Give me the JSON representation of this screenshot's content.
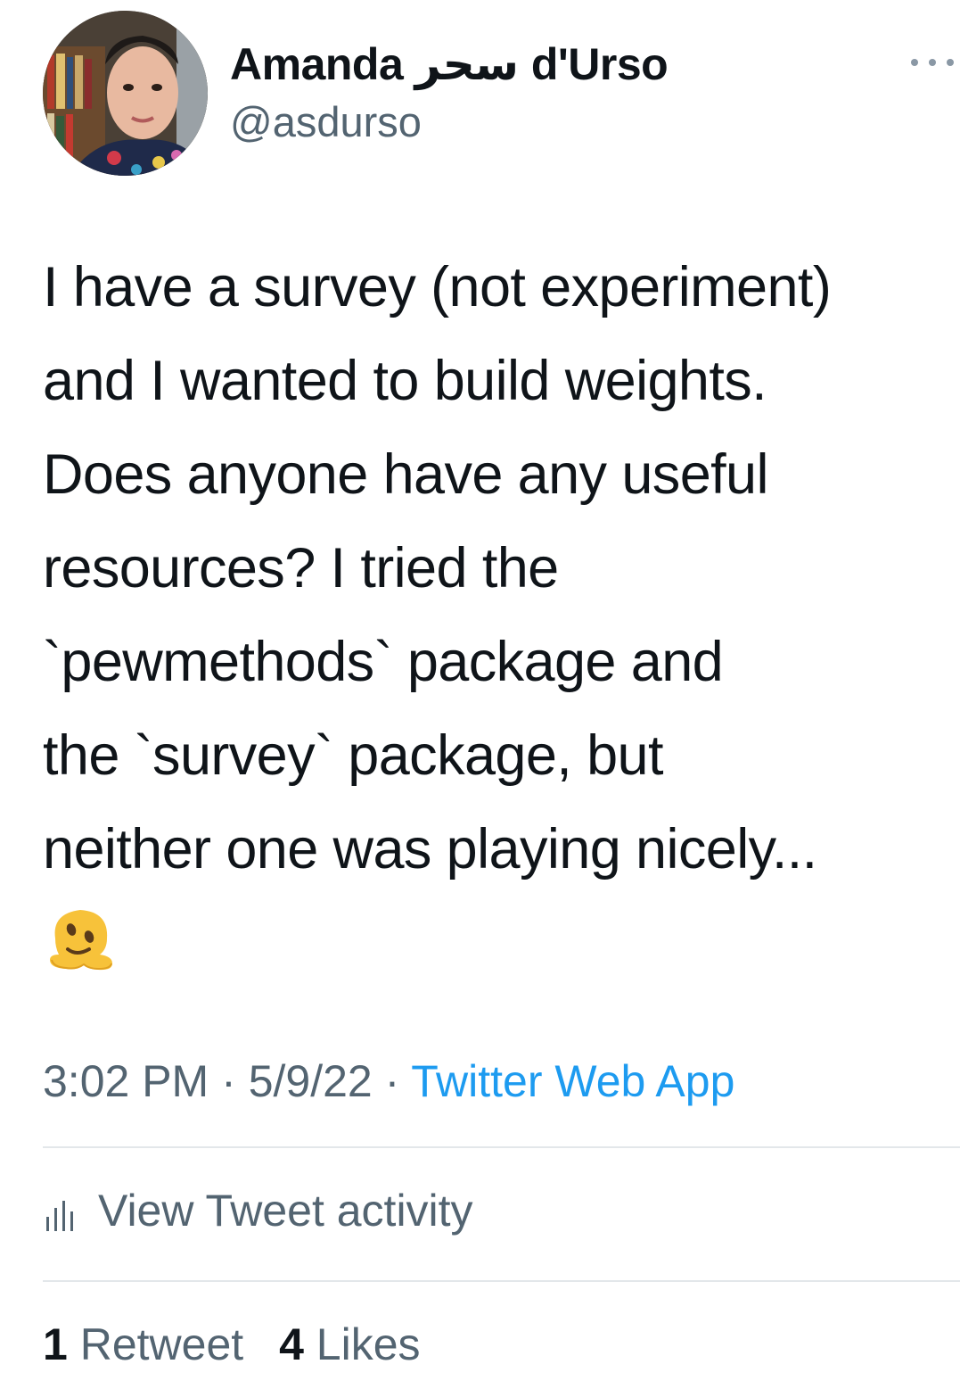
{
  "author": {
    "display_name": "Amanda سحر d'Urso",
    "handle": "@asdurso"
  },
  "tweet": {
    "text_lines": [
      "I have a survey (not experiment)",
      "and I wanted to build weights.",
      "Does anyone have any useful",
      "resources? I tried the",
      "`pewmethods` package and",
      "the `survey` package, but",
      "neither one was playing nicely..."
    ],
    "emoji": "melting-face-emoji"
  },
  "meta": {
    "time": "3:02 PM",
    "separator": "·",
    "date": "5/9/22",
    "source": "Twitter Web App"
  },
  "activity": {
    "label": "View Tweet activity",
    "icon": "bar-chart-icon"
  },
  "stats": {
    "retweets_count": "1",
    "retweets_label": "Retweet",
    "likes_count": "4",
    "likes_label": "Likes"
  },
  "colors": {
    "primary_text": "#0f1419",
    "secondary_text": "#536471",
    "link": "#1d9bf0",
    "divider": "#e3e7ea"
  }
}
